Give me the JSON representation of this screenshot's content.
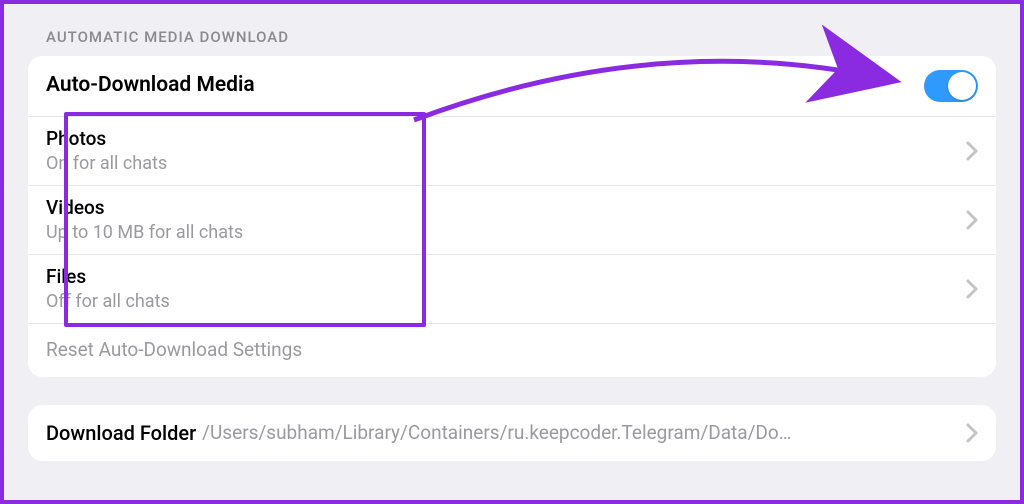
{
  "section_header": "AUTOMATIC MEDIA DOWNLOAD",
  "master_row": {
    "title": "Auto-Download Media",
    "toggle_on": true
  },
  "media_rows": [
    {
      "title": "Photos",
      "subtitle": "On for all chats"
    },
    {
      "title": "Videos",
      "subtitle": "Up to 10 MB for all chats"
    },
    {
      "title": "Files",
      "subtitle": "Off for all chats"
    }
  ],
  "reset_label": "Reset Auto-Download Settings",
  "download_folder": {
    "label": "Download Folder",
    "path": "/Users/subham/Library/Containers/ru.keepcoder.Telegram/Data/Do…"
  },
  "annotation": {
    "highlight_color": "#8a2be2"
  }
}
